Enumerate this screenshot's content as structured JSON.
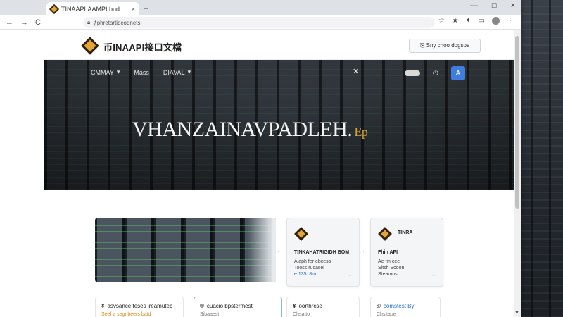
{
  "browser": {
    "tab_title": "ΤΙΝΑΑΡLAAMPI bud",
    "tab_close": "×",
    "new_tab": "+",
    "url": "ƒphretartiqcodnets",
    "window_controls": [
      "—",
      "□",
      "×"
    ],
    "nav_back": "←",
    "nav_forward": "→",
    "nav_reload": "C",
    "toolbar_icons": [
      "☆",
      "★",
      "✦",
      "▭"
    ]
  },
  "site": {
    "logo_text": "币INAAPI接口文檔",
    "header_button": "⎘  Sny choo dogsos"
  },
  "hero": {
    "nav": [
      {
        "label": "CMMAY",
        "caret": "▾"
      },
      {
        "label": "Mass",
        "caret": ""
      },
      {
        "label": "DIAVAL",
        "caret": "▾"
      }
    ],
    "close": "✕",
    "icon_power": "⏻",
    "icon_user": "A",
    "title": "VHANZAINAVPADLEH.",
    "title_accent": "Ep"
  },
  "content": {
    "arrow1": "→",
    "arrow2": "→",
    "cards": [
      {
        "title": "TINKAHATRIGIDH BOM",
        "line1": "A aph fer ebcess",
        "line2": "Tooss rucasel",
        "line3": "e  135 .8m",
        "plus": "+"
      },
      {
        "title": "TINRA",
        "line_title": "Fhin API",
        "line1": "Ae fin cee",
        "line2": "Sitsh Scoon",
        "line3": "Steamns",
        "plus": "+"
      }
    ],
    "bottom_cards": [
      {
        "sym": "¥",
        "title": "asvsance teses ireamutec",
        "sub": "Seef a segnbeers batd",
        "style": "orange"
      },
      {
        "sym": "®",
        "title": "cuacio bpstermest",
        "sub": "Sibaaest",
        "style": "grey"
      },
      {
        "sym": "¥",
        "title": "oorthrcse",
        "sub": "Chsatto",
        "style": "grey"
      },
      {
        "sym": "©",
        "title": "comstest By",
        "sub": "Chsitaue",
        "style": "grey"
      }
    ]
  },
  "colors": {
    "accent_gold": "#e6a436",
    "accent_blue": "#3f7ee0"
  }
}
